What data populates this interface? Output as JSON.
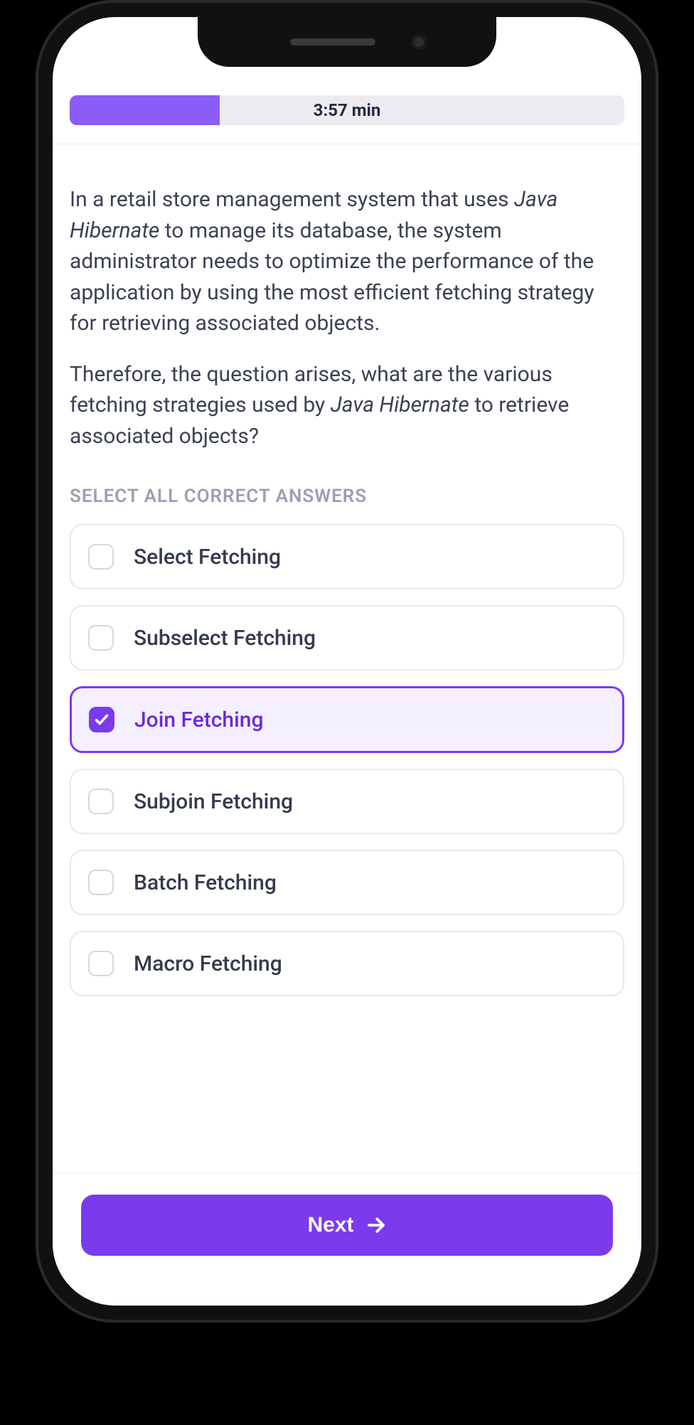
{
  "colors": {
    "accent": "#7c3aed",
    "accentLight": "#8b5cf6",
    "selectedBg": "#f5f0ff",
    "text": "#3b4252",
    "muted": "#9aa0b0"
  },
  "progress": {
    "percent": 27,
    "timer": "3:57 min"
  },
  "question": {
    "p1_a": "In a retail store management system that uses ",
    "p1_em": "Java Hibernate",
    "p1_b": " to manage its database, the system administrator needs to optimize the performance of the application by using the most efficient fetching strategy for retrieving associated objects.",
    "p2_a": "Therefore, the question arises, what are the various fetching strategies used by ",
    "p2_em": "Java Hibernate",
    "p2_b": " to retrieve associated objects?"
  },
  "instruction": "SELECT ALL CORRECT ANSWERS",
  "answers": [
    {
      "label": "Select Fetching",
      "selected": false
    },
    {
      "label": "Subselect Fetching",
      "selected": false
    },
    {
      "label": "Join Fetching",
      "selected": true
    },
    {
      "label": "Subjoin Fetching",
      "selected": false
    },
    {
      "label": "Batch Fetching",
      "selected": false
    },
    {
      "label": "Macro Fetching",
      "selected": false
    }
  ],
  "nextLabel": "Next"
}
